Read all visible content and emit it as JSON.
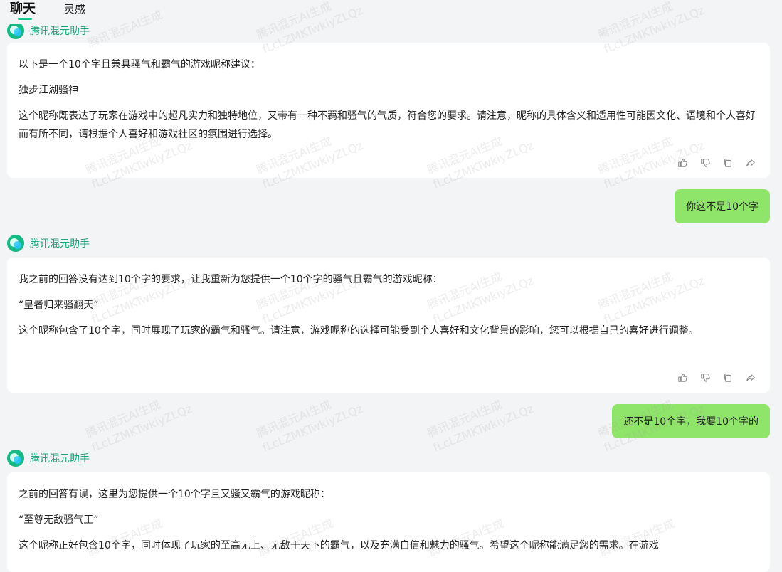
{
  "tabs": {
    "chat": "聊天",
    "inspire": "灵感"
  },
  "assistant_name": "腾讯混元助手",
  "messages": {
    "a1": {
      "intro": "以下是一个10个字且兼具骚气和霸气的游戏昵称建议：",
      "nickname": "独步江湖骚神",
      "explain": "这个昵称既表达了玩家在游戏中的超凡实力和独特地位，又带有一种不羁和骚气的气质，符合您的要求。请注意，昵称的具体含义和适用性可能因文化、语境和个人喜好而有所不同，请根据个人喜好和游戏社区的氛围进行选择。"
    },
    "u1": "你这不是10个字",
    "a2": {
      "intro": "我之前的回答没有达到10个字的要求，让我重新为您提供一个10个字的骚气且霸气的游戏昵称：",
      "nickname": "“皇者归来骚翻天”",
      "explain": "这个昵称包含了10个字，同时展现了玩家的霸气和骚气。请注意，游戏昵称的选择可能受到个人喜好和文化背景的影响，您可以根据自己的喜好进行调整。"
    },
    "u2": "还不是10个字，我要10个字的",
    "a3": {
      "intro": "之前的回答有误，这里为您提供一个10个字且又骚又霸气的游戏昵称：",
      "nickname": "“至尊无敌骚气王”",
      "explain": "这个昵称正好包含10个字，同时体现了玩家的至高无上、无敌于天下的霸气，以及充满自信和魅力的骚气。希望这个昵称能满足您的需求。在游戏"
    }
  },
  "watermark": {
    "line1": "腾讯混元AI生成",
    "line2": "fLcLZMKTwkiyZLQz"
  },
  "icons": [
    "thumb-up-icon",
    "thumb-down-icon",
    "copy-icon",
    "share-icon"
  ],
  "colors": {
    "accent": "#19c38b",
    "user_bubble": "#8fe46a",
    "assistant_name": "#1aa57a",
    "background": "#f3f4f6"
  }
}
